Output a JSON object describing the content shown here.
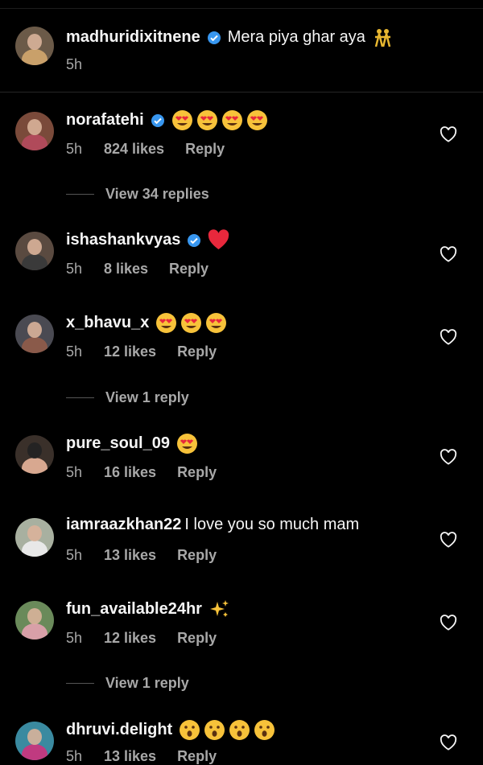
{
  "caption": {
    "username": "madhuridixitnene",
    "text": "Mera piya ghar aya",
    "time": "5h"
  },
  "comments": [
    {
      "username": "norafatehi",
      "verified": true,
      "text": "",
      "emoji_count": 4,
      "emoji": "heart-eyes",
      "time": "5h",
      "likes": "824 likes",
      "reply": "Reply"
    },
    {
      "username": "ishashankvyas",
      "verified": true,
      "text": "",
      "emoji_count": 1,
      "emoji": "red-heart",
      "time": "5h",
      "likes": "8 likes",
      "reply": "Reply"
    },
    {
      "username": "x_bhavu_x",
      "verified": false,
      "text": "",
      "emoji_count": 3,
      "emoji": "heart-eyes",
      "time": "5h",
      "likes": "12 likes",
      "reply": "Reply"
    },
    {
      "username": "pure_soul_09",
      "verified": false,
      "text": "",
      "emoji_count": 1,
      "emoji": "heart-eyes",
      "time": "5h",
      "likes": "16 likes",
      "reply": "Reply"
    },
    {
      "username": "iamraazkhan22",
      "verified": false,
      "text": "I love you so much mam",
      "emoji_count": 0,
      "emoji": "",
      "time": "5h",
      "likes": "13 likes",
      "reply": "Reply"
    },
    {
      "username": "fun_available24hr",
      "verified": false,
      "text": "",
      "emoji_count": 1,
      "emoji": "sparkles",
      "time": "5h",
      "likes": "12 likes",
      "reply": "Reply"
    },
    {
      "username": "dhruvi.delight",
      "verified": false,
      "text": "",
      "emoji_count": 4,
      "emoji": "open-mouth",
      "time": "5h",
      "likes": "13 likes",
      "reply": "Reply"
    }
  ],
  "view_replies": {
    "norafatehi": "View 34 replies",
    "x_bhavu_x": "View 1 reply",
    "fun_available24hr": "View 1 reply"
  },
  "colors": {
    "background": "#000000",
    "text": "#f5f5f5",
    "secondary": "#a8a8a8",
    "verified": "#3897f0"
  },
  "icons": {
    "verified": "verified-badge-icon",
    "like": "heart-outline-icon"
  }
}
